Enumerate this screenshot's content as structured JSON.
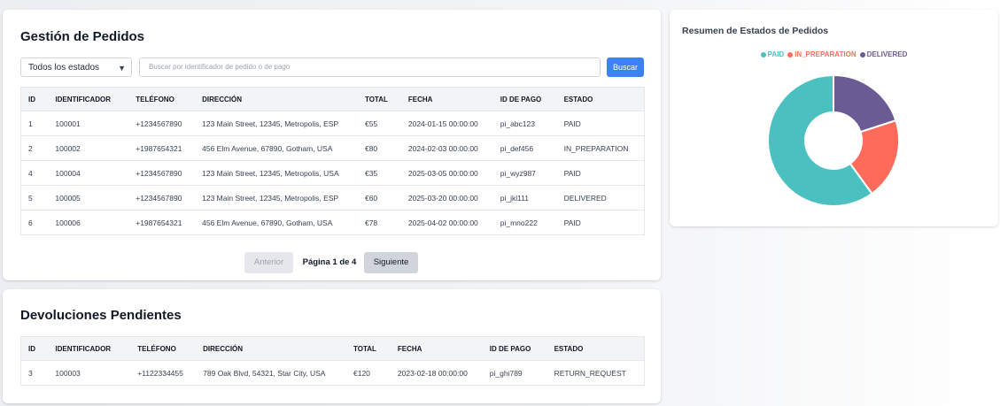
{
  "orders": {
    "title": "Gestión de Pedidos",
    "filter_selected": "Todos los estados",
    "search_placeholder": "Buscar por identificador de pedido o de pago",
    "search_button": "Buscar",
    "columns": [
      "ID",
      "IDENTIFICADOR",
      "TELÉFONO",
      "DIRECCIÓN",
      "TOTAL",
      "FECHA",
      "ID DE PAGO",
      "ESTADO"
    ],
    "rows": [
      [
        "1",
        "100001",
        "+1234567890",
        "123 Main Street, 12345, Metropolis, ESP",
        "€55",
        "2024-01-15 00:00:00",
        "pi_abc123",
        "PAID"
      ],
      [
        "2",
        "100002",
        "+1987654321",
        "456 Elm Avenue, 67890, Gotham, USA",
        "€80",
        "2024-02-03 00:00:00",
        "pi_def456",
        "IN_PREPARATION"
      ],
      [
        "4",
        "100004",
        "+1234567890",
        "123 Main Street, 12345, Metropolis, USA",
        "€35",
        "2025-03-05 00:00:00",
        "pi_wyz987",
        "PAID"
      ],
      [
        "5",
        "100005",
        "+1234567890",
        "123 Main Street, 12345, Metropolis, ESP",
        "€60",
        "2025-03-20 00:00:00",
        "pi_jkl111",
        "DELIVERED"
      ],
      [
        "6",
        "100006",
        "+1987654321",
        "456 Elm Avenue, 67890, Gotham, USA",
        "€78",
        "2025-04-02 00:00:00",
        "pi_mno222",
        "PAID"
      ]
    ],
    "pagination": {
      "prev": "Anterior",
      "info": "Página 1 de 4",
      "next": "Siguiente"
    }
  },
  "returns": {
    "title": "Devoluciones Pendientes",
    "columns": [
      "ID",
      "IDENTIFICADOR",
      "TELÉFONO",
      "DIRECCIÓN",
      "TOTAL",
      "FECHA",
      "ID DE PAGO",
      "ESTADO"
    ],
    "rows": [
      [
        "3",
        "100003",
        "+1122334455",
        "789 Oak Blvd, 54321, Star City, USA",
        "€120",
        "2023-02-18 00:00:00",
        "pi_ghi789",
        "RETURN_REQUEST"
      ]
    ]
  },
  "chart": {
    "title": "Resumen de Estados de Pedidos"
  },
  "chart_data": {
    "type": "pie",
    "categories": [
      "PAID",
      "IN_PREPARATION",
      "DELIVERED"
    ],
    "values": [
      3,
      1,
      1
    ],
    "colors": [
      "#4bc0c0",
      "#ff6b5b",
      "#6b5b95"
    ],
    "legend": "top"
  }
}
